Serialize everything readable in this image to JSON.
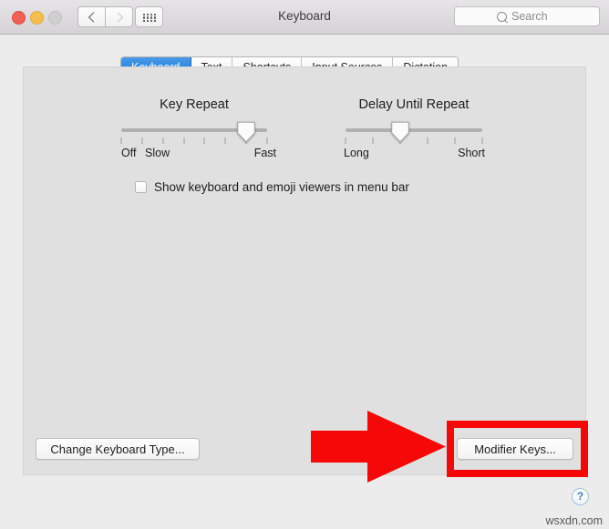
{
  "window": {
    "title": "Keyboard",
    "traffic_lights": [
      "close",
      "minimize",
      "zoom"
    ],
    "nav_back_icon": "chevron-left-icon",
    "nav_forward_icon": "chevron-right-icon",
    "show_all_icon": "grid-dots-icon"
  },
  "search": {
    "placeholder": "Search",
    "icon": "search-icon"
  },
  "tabs": [
    {
      "label": "Keyboard",
      "selected": true
    },
    {
      "label": "Text",
      "selected": false
    },
    {
      "label": "Shortcuts",
      "selected": false
    },
    {
      "label": "Input Sources",
      "selected": false
    },
    {
      "label": "Dictation",
      "selected": false
    }
  ],
  "sliders": [
    {
      "name": "key-repeat",
      "title": "Key Repeat",
      "tick_count": 8,
      "value_index": 6,
      "labels": [
        {
          "text": "Off",
          "align": "left"
        },
        {
          "text": "Slow",
          "align": "second"
        },
        {
          "text": "Fast",
          "align": "right"
        }
      ]
    },
    {
      "name": "delay-until-repeat",
      "title": "Delay Until Repeat",
      "tick_count": 6,
      "value_index": 2,
      "labels": [
        {
          "text": "Long",
          "align": "left"
        },
        {
          "text": "Short",
          "align": "right"
        }
      ]
    }
  ],
  "checkbox": {
    "label": "Show keyboard and emoji viewers in menu bar",
    "checked": false
  },
  "buttons": {
    "change_keyboard_type": "Change Keyboard Type...",
    "modifier_keys": "Modifier Keys..."
  },
  "help": {
    "label": "?"
  },
  "watermark": {
    "text": "wsxdn.com"
  },
  "annotations": {
    "color": "#f60808",
    "arrow": "right-arrow-annotation",
    "highlight": "red-rectangle-highlight",
    "target": "Modifier Keys..."
  }
}
